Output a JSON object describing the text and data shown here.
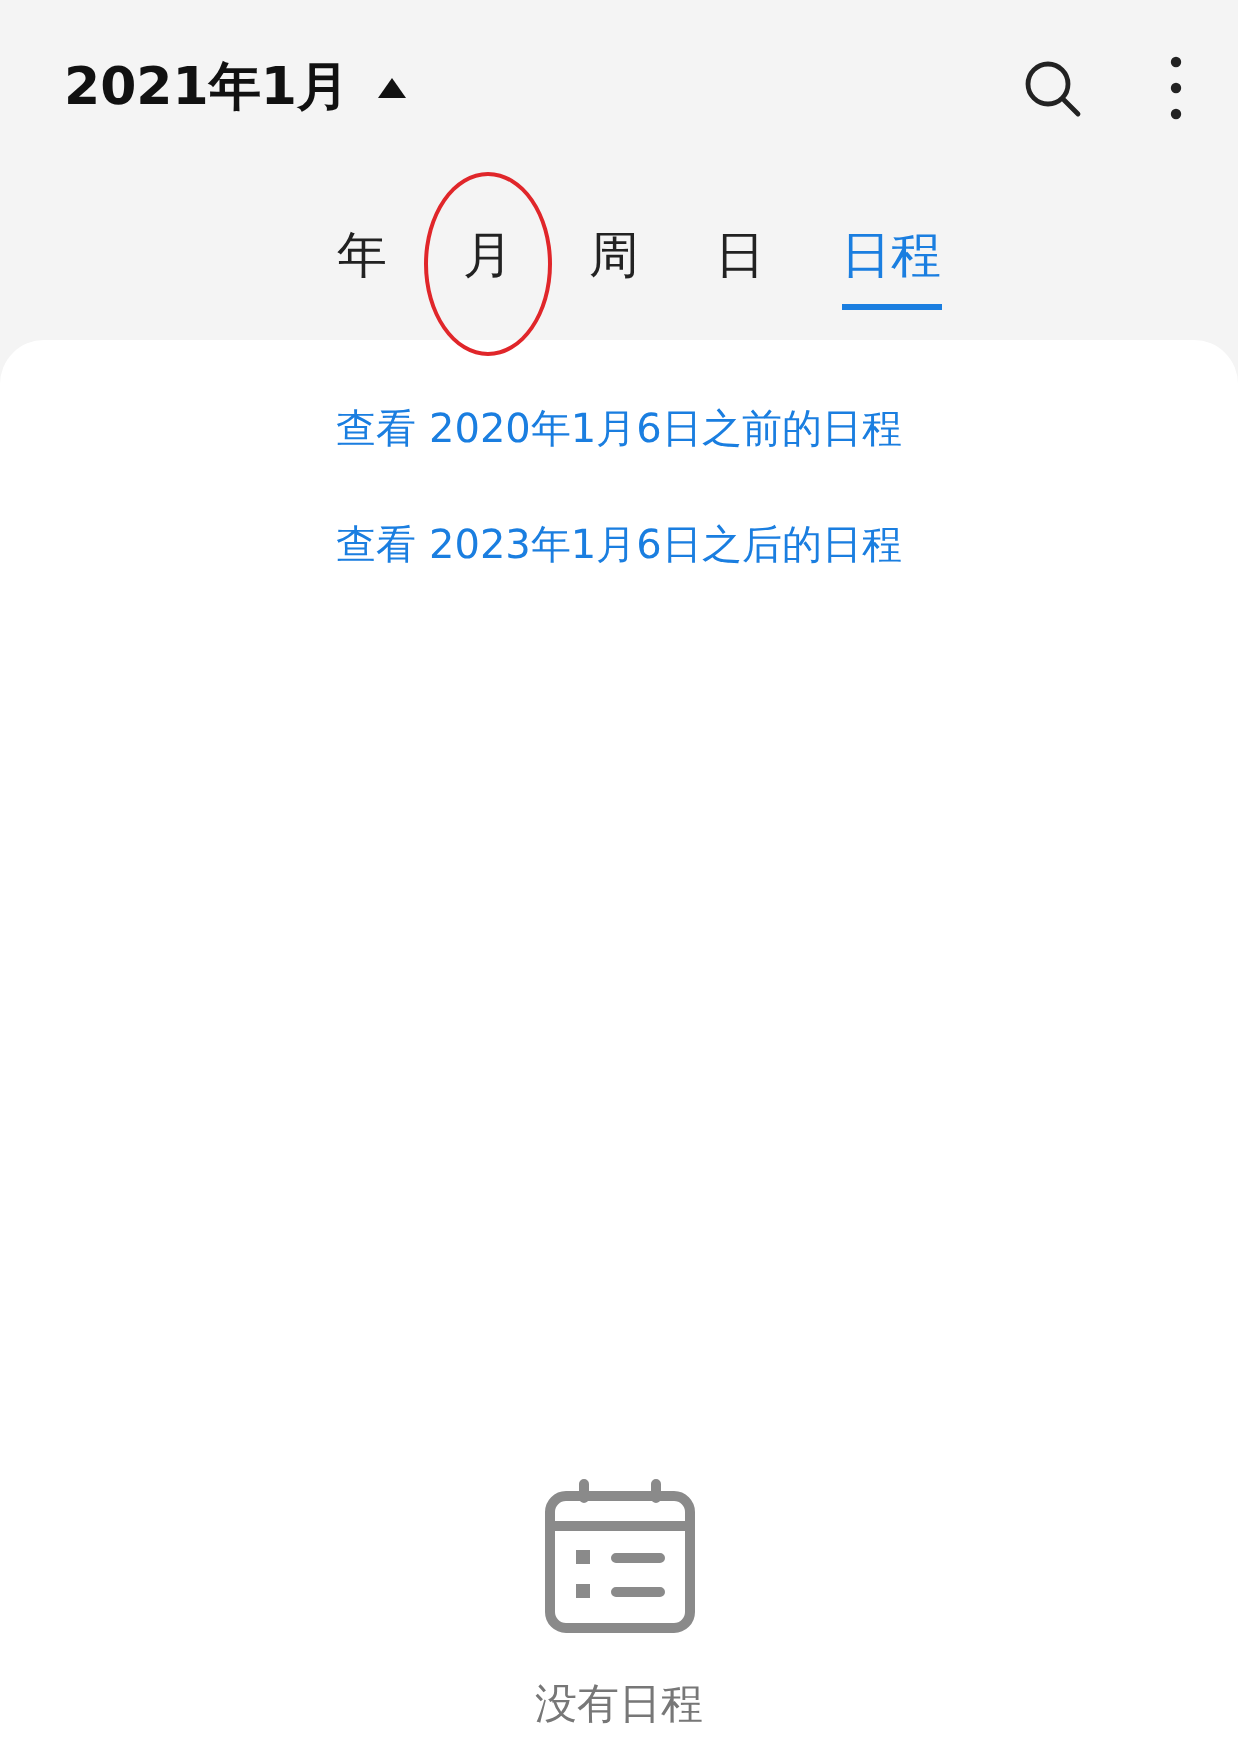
{
  "header": {
    "title": "2021年1月",
    "expanded": true
  },
  "tabs": [
    {
      "label": "年",
      "selected": false,
      "circled": false
    },
    {
      "label": "月",
      "selected": false,
      "circled": true
    },
    {
      "label": "周",
      "selected": false,
      "circled": false
    },
    {
      "label": "日",
      "selected": false,
      "circled": false
    },
    {
      "label": "日程",
      "selected": true,
      "circled": false
    }
  ],
  "links": [
    "查看 2020年1月6日之前的日程",
    "查看 2023年1月6日之后的日程"
  ],
  "empty_state": {
    "message": "没有日程"
  }
}
